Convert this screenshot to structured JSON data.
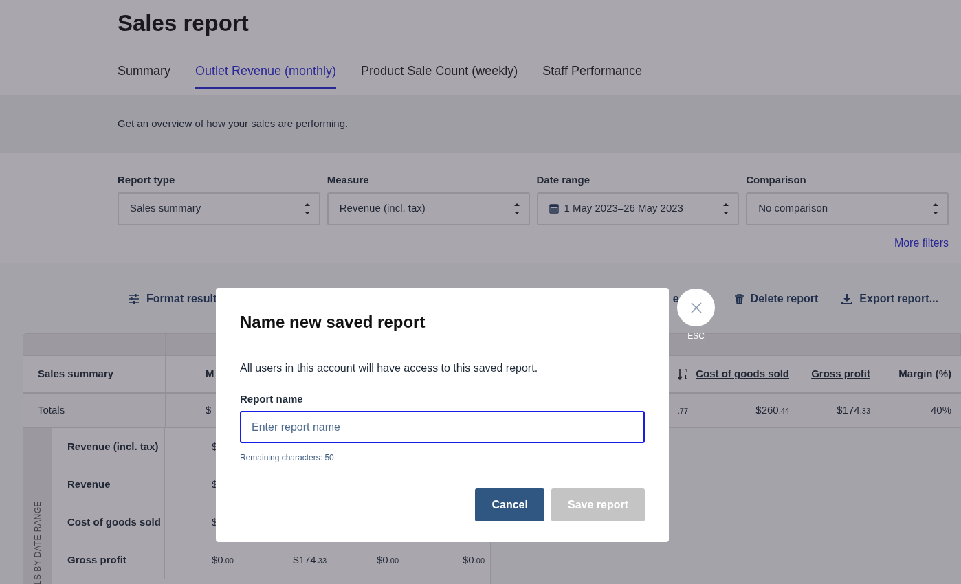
{
  "page": {
    "title": "Sales report"
  },
  "tabs": [
    {
      "label": "Summary",
      "selected": false
    },
    {
      "label": "Outlet Revenue (monthly)",
      "selected": true
    },
    {
      "label": "Product Sale Count (weekly)",
      "selected": false
    },
    {
      "label": "Staff Performance",
      "selected": false
    }
  ],
  "description": "Get an overview of how your sales are performing.",
  "filters": [
    {
      "label": "Report type",
      "value": "Sales summary",
      "kind": "select"
    },
    {
      "label": "Measure",
      "value": "Revenue (incl. tax)",
      "kind": "select"
    },
    {
      "label": "Date range",
      "value": "1 May 2023–26 May 2023",
      "kind": "date"
    },
    {
      "label": "Comparison",
      "value": "No comparison",
      "kind": "select"
    }
  ],
  "more_filters": "More filters",
  "toolbar": [
    {
      "label": "Format result",
      "kind": "format"
    },
    {
      "label": "e",
      "kind": "fragment"
    },
    {
      "label": "Delete report",
      "kind": "delete"
    },
    {
      "label": "Export report...",
      "kind": "export"
    }
  ],
  "table": {
    "corner_label": "Sales summary",
    "left_headers": [
      "M"
    ],
    "right_headers": [
      {
        "text": "Cost of goods sold",
        "link": true
      },
      {
        "text": "Gross profit",
        "link": true
      },
      {
        "text": "Margin (%)",
        "link": false
      }
    ],
    "totals": {
      "label": "Totals",
      "left": [
        {
          "main": "$"
        }
      ],
      "right": [
        {
          "cents": ".77"
        },
        {
          "main": "$260",
          "cents": ".44"
        },
        {
          "main": "$174",
          "cents": ".33"
        },
        {
          "main": "40%"
        }
      ]
    },
    "group_label": "LS BY DATE RANGE",
    "rows": [
      {
        "label": "Revenue (incl. tax)",
        "cells": [
          {
            "main": "$"
          }
        ]
      },
      {
        "label": "Revenue",
        "cells": [
          {
            "main": "$"
          }
        ]
      },
      {
        "label": "Cost of goods sold",
        "cells": [
          {
            "main": "$"
          }
        ]
      },
      {
        "label": "Gross profit",
        "cells": [
          {
            "main": "$0",
            "cents": ".00"
          },
          {
            "main": "$174",
            "cents": ".33"
          },
          {
            "main": "$0",
            "cents": ".00"
          },
          {
            "main": "$0",
            "cents": ".00"
          }
        ]
      }
    ]
  },
  "modal": {
    "title": "Name new saved report",
    "text": "All users in this account will have access to this saved report.",
    "field_label": "Report name",
    "placeholder": "Enter report name",
    "focused": true,
    "hint": "Remaining characters: 50",
    "buttons": [
      {
        "label": "Cancel",
        "kind": "secondary",
        "disabled": false
      },
      {
        "label": "Save report",
        "kind": "primary",
        "disabled": true
      }
    ],
    "close_label": "ESC"
  }
}
